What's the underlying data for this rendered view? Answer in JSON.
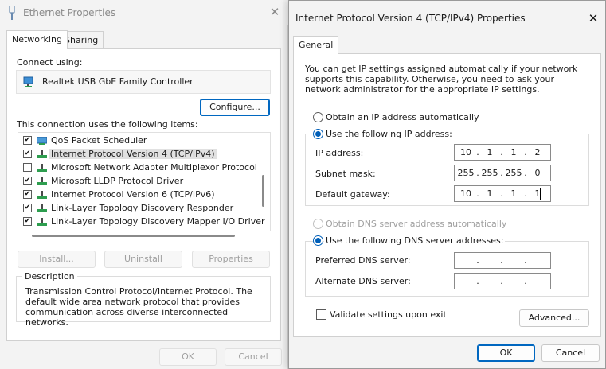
{
  "ethernet": {
    "title": "Ethernet Properties",
    "tabs": [
      "Networking",
      "Sharing"
    ],
    "connect_using_label": "Connect using:",
    "adapter_name": "Realtek USB GbE Family Controller",
    "configure_label": "Configure...",
    "items_label": "This connection uses the following items:",
    "items": [
      {
        "label": "QoS Packet Scheduler",
        "checked": true
      },
      {
        "label": "Internet Protocol Version 4 (TCP/IPv4)",
        "checked": true
      },
      {
        "label": "Microsoft Network Adapter Multiplexor Protocol",
        "checked": false
      },
      {
        "label": "Microsoft LLDP Protocol Driver",
        "checked": true
      },
      {
        "label": "Internet Protocol Version 6 (TCP/IPv6)",
        "checked": true
      },
      {
        "label": "Link-Layer Topology Discovery Responder",
        "checked": true
      },
      {
        "label": "Link-Layer Topology Discovery Mapper I/O Driver",
        "checked": true
      }
    ],
    "install_label": "Install...",
    "uninstall_label": "Uninstall",
    "properties_label": "Properties",
    "description_title": "Description",
    "description_text": "Transmission Control Protocol/Internet Protocol. The default wide area network protocol that provides communication across diverse interconnected networks.",
    "ok_label": "OK",
    "cancel_label": "Cancel"
  },
  "ipv4": {
    "title": "Internet Protocol Version 4 (TCP/IPv4) Properties",
    "tab": "General",
    "intro": "You can get IP settings assigned automatically if your network supports this capability. Otherwise, you need to ask your network administrator for the appropriate IP settings.",
    "obtain_ip_auto": "Obtain an IP address automatically",
    "use_following_ip": "Use the following IP address:",
    "ip_address_label": "IP address:",
    "ip_address": [
      "10",
      "1",
      "1",
      "2"
    ],
    "subnet_label": "Subnet mask:",
    "subnet": [
      "255",
      "255",
      "255",
      "0"
    ],
    "gateway_label": "Default gateway:",
    "gateway": [
      "10",
      "1",
      "1",
      "1"
    ],
    "obtain_dns_auto": "Obtain DNS server address automatically",
    "use_following_dns": "Use the following DNS server addresses:",
    "preferred_dns_label": "Preferred DNS server:",
    "preferred_dns": [
      "",
      "",
      "",
      ""
    ],
    "alternate_dns_label": "Alternate DNS server:",
    "alternate_dns": [
      "",
      "",
      "",
      ""
    ],
    "validate_label": "Validate settings upon exit",
    "advanced_label": "Advanced...",
    "ok_label": "OK",
    "cancel_label": "Cancel"
  },
  "colors": {
    "accent": "#005fb8",
    "dialog_bg": "#f3f3f3",
    "disabled_text": "#a0a0a0"
  }
}
